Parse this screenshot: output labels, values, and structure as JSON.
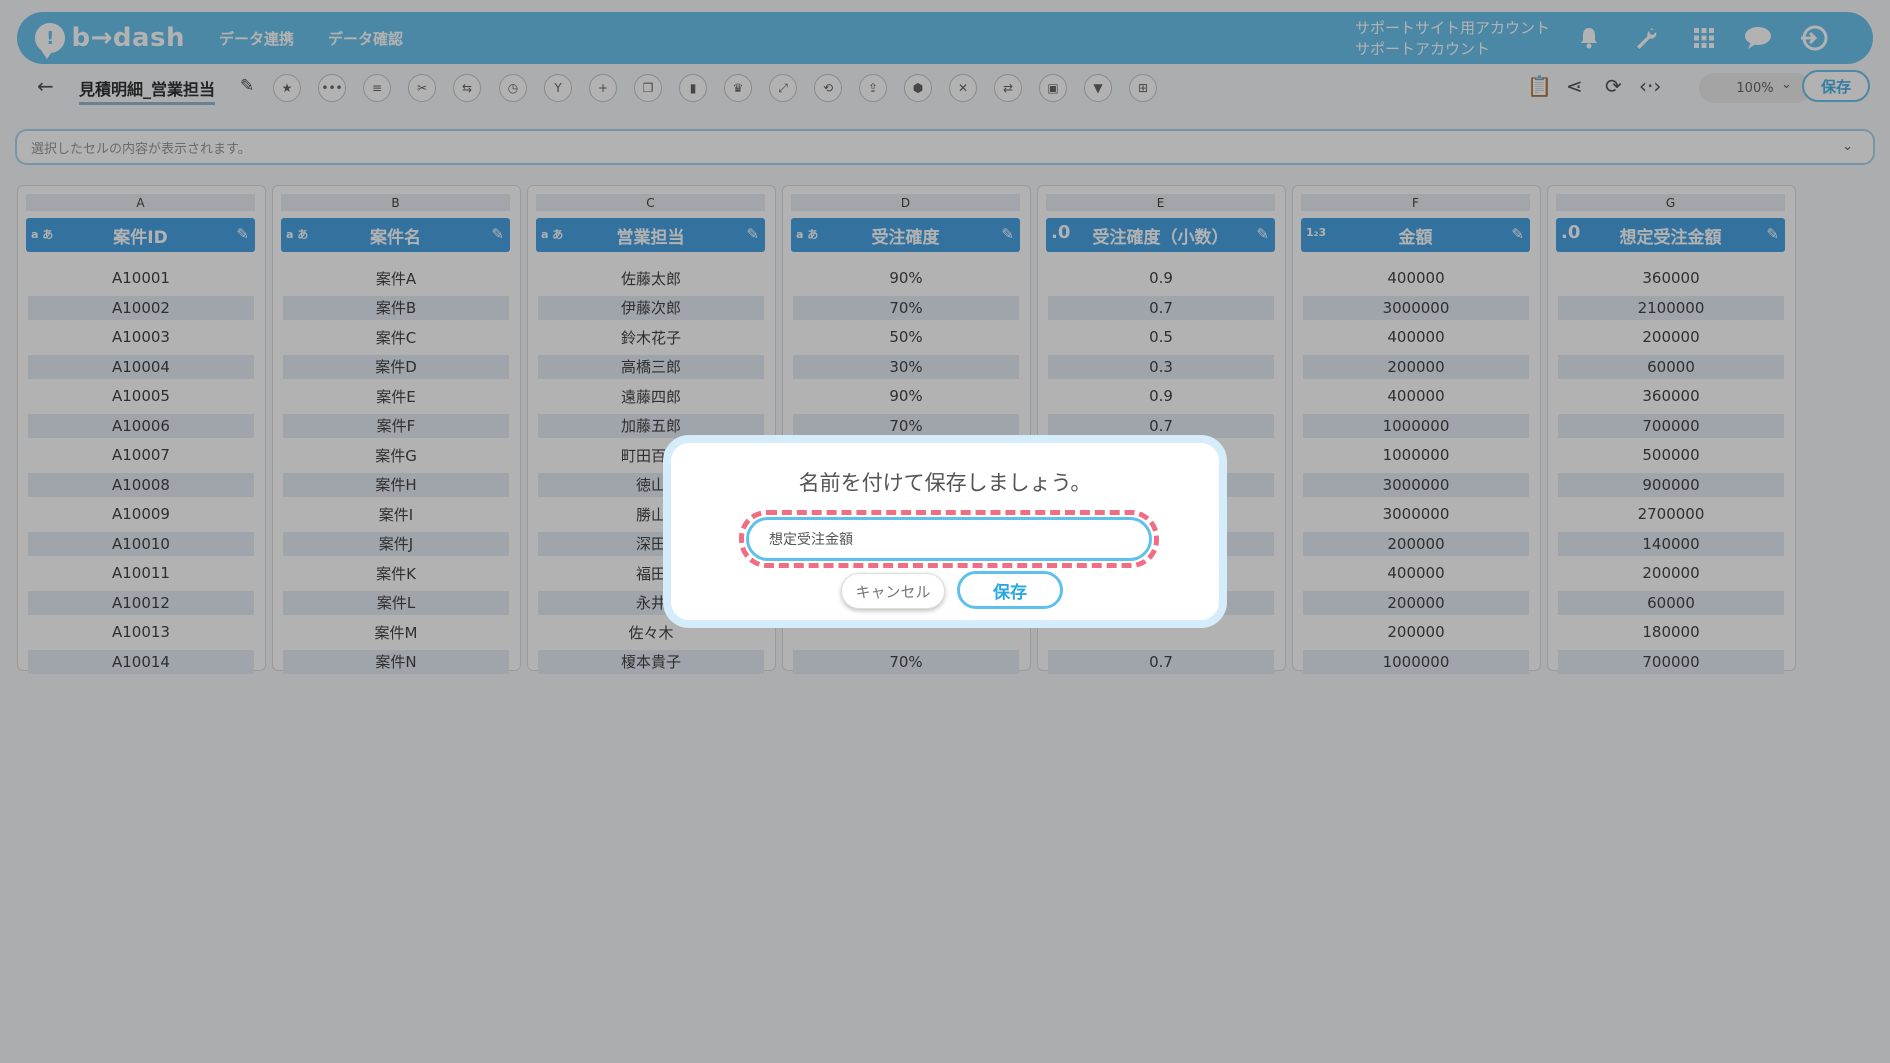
{
  "header": {
    "logo_mark": "!",
    "logo_text": "b→dash",
    "nav": [
      "データ連携",
      "データ確認"
    ],
    "account_line1": "サポートサイト用アカウント",
    "account_line2": "サポートアカウント",
    "icons": [
      "bell-icon",
      "wrench-icon",
      "grid-icon",
      "chat-icon",
      "logout-icon"
    ]
  },
  "toolbar": {
    "title": "見積明細_営業担当",
    "zoom": "100%",
    "save_label": "保存"
  },
  "cellbar": {
    "placeholder": "選択したセルの内容が表示されます。"
  },
  "columns": [
    {
      "letter": "A",
      "type": "a あ",
      "name": "案件ID",
      "values": [
        "A10001",
        "A10002",
        "A10003",
        "A10004",
        "A10005",
        "A10006",
        "A10007",
        "A10008",
        "A10009",
        "A10010",
        "A10011",
        "A10012",
        "A10013",
        "A10014"
      ]
    },
    {
      "letter": "B",
      "type": "a あ",
      "name": "案件名",
      "values": [
        "案件A",
        "案件B",
        "案件C",
        "案件D",
        "案件E",
        "案件F",
        "案件G",
        "案件H",
        "案件I",
        "案件J",
        "案件K",
        "案件L",
        "案件M",
        "案件N"
      ]
    },
    {
      "letter": "C",
      "type": "a あ",
      "name": "営業担当",
      "values": [
        "佐藤太郎",
        "伊藤次郎",
        "鈴木花子",
        "高橋三郎",
        "遠藤四郎",
        "加藤五郎",
        "町田百合",
        "徳山",
        "勝山",
        "深田",
        "福田",
        "永井",
        "佐々木",
        "榎本貴子"
      ]
    },
    {
      "letter": "D",
      "type": "a あ",
      "name": "受注確度",
      "values": [
        "90%",
        "70%",
        "50%",
        "30%",
        "90%",
        "70%",
        "",
        "",
        "",
        "",
        "",
        "",
        "",
        "70%"
      ]
    },
    {
      "letter": "E",
      "type": ".0",
      "name": "受注確度（小数）",
      "values": [
        "0.9",
        "0.7",
        "0.5",
        "0.3",
        "0.9",
        "0.7",
        "",
        "",
        "",
        "",
        "",
        "",
        "",
        "0.7"
      ]
    },
    {
      "letter": "F",
      "type": "1₂3",
      "name": "金額",
      "values": [
        "400000",
        "3000000",
        "400000",
        "200000",
        "400000",
        "1000000",
        "1000000",
        "3000000",
        "3000000",
        "200000",
        "400000",
        "200000",
        "200000",
        "1000000"
      ]
    },
    {
      "letter": "G",
      "type": ".0",
      "name": "想定受注金額",
      "values": [
        "360000",
        "2100000",
        "200000",
        "60000",
        "360000",
        "700000",
        "500000",
        "900000",
        "2700000",
        "140000",
        "200000",
        "60000",
        "180000",
        "700000"
      ]
    }
  ],
  "modal": {
    "title": "名前を付けて保存しましょう。",
    "input_value": "想定受注金額",
    "cancel_label": "キャンセル",
    "save_label": "保存"
  }
}
